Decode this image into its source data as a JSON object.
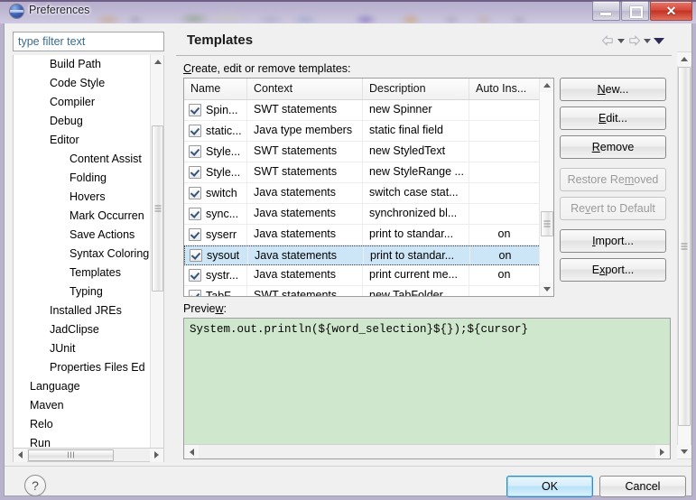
{
  "window": {
    "title": "Preferences",
    "icon": "eclipse-sphere-icon",
    "minimize_label": "Minimize",
    "maximize_label": "Maximize",
    "close_label": "✕"
  },
  "filter": {
    "placeholder": "type filter text",
    "value": ""
  },
  "tree": {
    "items": [
      {
        "label": "Build Path",
        "indent": 1,
        "selected": false
      },
      {
        "label": "Code Style",
        "indent": 1,
        "selected": false
      },
      {
        "label": "Compiler",
        "indent": 1,
        "selected": false
      },
      {
        "label": "Debug",
        "indent": 1,
        "selected": false
      },
      {
        "label": "Editor",
        "indent": 1,
        "selected": false
      },
      {
        "label": "Content Assist",
        "indent": 2,
        "selected": false
      },
      {
        "label": "Folding",
        "indent": 2,
        "selected": false
      },
      {
        "label": "Hovers",
        "indent": 2,
        "selected": false
      },
      {
        "label": "Mark Occurren",
        "indent": 2,
        "selected": false
      },
      {
        "label": "Save Actions",
        "indent": 2,
        "selected": false
      },
      {
        "label": "Syntax Coloring",
        "indent": 2,
        "selected": false
      },
      {
        "label": "Templates",
        "indent": 2,
        "selected": true
      },
      {
        "label": "Typing",
        "indent": 2,
        "selected": false
      },
      {
        "label": "Installed JREs",
        "indent": 1,
        "selected": false
      },
      {
        "label": "JadClipse",
        "indent": 1,
        "selected": false
      },
      {
        "label": "JUnit",
        "indent": 1,
        "selected": false
      },
      {
        "label": "Properties Files Ed",
        "indent": 1,
        "selected": false
      },
      {
        "label": "Language",
        "indent": 0,
        "selected": false
      },
      {
        "label": "Maven",
        "indent": 0,
        "selected": false
      },
      {
        "label": "Relo",
        "indent": 0,
        "selected": false
      },
      {
        "label": "Run",
        "indent": 0,
        "selected": false
      }
    ]
  },
  "page": {
    "title": "Templates",
    "section_label_pre": "C",
    "section_label_post": "reate, edit or remove templates:",
    "nav": {
      "back": "back-arrow",
      "back_menu": "back-dropdown",
      "forward": "forward-arrow",
      "forward_menu": "forward-dropdown",
      "view_menu": "view-menu-dropdown"
    }
  },
  "table": {
    "columns": [
      "Name",
      "Context",
      "Description",
      "Auto Ins..."
    ],
    "rows": [
      {
        "checked": true,
        "name": "Spin...",
        "context": "SWT statements",
        "description": "new Spinner",
        "auto": "",
        "selected": false
      },
      {
        "checked": true,
        "name": "static...",
        "context": "Java type members",
        "description": "static final field",
        "auto": "",
        "selected": false
      },
      {
        "checked": true,
        "name": "Style...",
        "context": "SWT statements",
        "description": "new StyledText",
        "auto": "",
        "selected": false
      },
      {
        "checked": true,
        "name": "Style...",
        "context": "SWT statements",
        "description": "new StyleRange ...",
        "auto": "",
        "selected": false
      },
      {
        "checked": true,
        "name": "switch",
        "context": "Java statements",
        "description": "switch case stat...",
        "auto": "",
        "selected": false
      },
      {
        "checked": true,
        "name": "sync...",
        "context": "Java statements",
        "description": "synchronized bl...",
        "auto": "",
        "selected": false
      },
      {
        "checked": true,
        "name": "syserr",
        "context": "Java statements",
        "description": "print to standar...",
        "auto": "on",
        "selected": false
      },
      {
        "checked": true,
        "name": "sysout",
        "context": "Java statements",
        "description": "print to standar...",
        "auto": "on",
        "selected": true
      },
      {
        "checked": true,
        "name": "systr...",
        "context": "Java statements",
        "description": "print current me...",
        "auto": "on",
        "selected": false
      },
      {
        "checked": true,
        "name": "TabF...",
        "context": "SWT statements",
        "description": "new TabFolder",
        "auto": "",
        "selected": false
      }
    ]
  },
  "side_buttons": [
    {
      "label": "New...",
      "mnemonic": "N",
      "disabled": false,
      "name": "new-button"
    },
    {
      "label": "Edit...",
      "mnemonic": "E",
      "disabled": false,
      "name": "edit-button"
    },
    {
      "label": "Remove",
      "mnemonic": "R",
      "disabled": false,
      "name": "remove-button"
    },
    {
      "label": "Restore Removed",
      "mnemonic": "m",
      "disabled": true,
      "name": "restore-removed-button"
    },
    {
      "label": "Revert to Default",
      "mnemonic": "v",
      "disabled": true,
      "name": "revert-to-default-button"
    },
    {
      "label": "Import...",
      "mnemonic": "I",
      "disabled": false,
      "name": "import-button"
    },
    {
      "label": "Export...",
      "mnemonic": "x",
      "disabled": false,
      "name": "export-button"
    }
  ],
  "preview": {
    "label_pre": "Previe",
    "label_mnemonic": "w",
    "label_post": ":",
    "code": "System.out.println(${word_selection}${});${cursor}",
    "background_color": "#cfe7cc"
  },
  "footer": {
    "help": "?",
    "ok": "OK",
    "cancel": "Cancel"
  }
}
